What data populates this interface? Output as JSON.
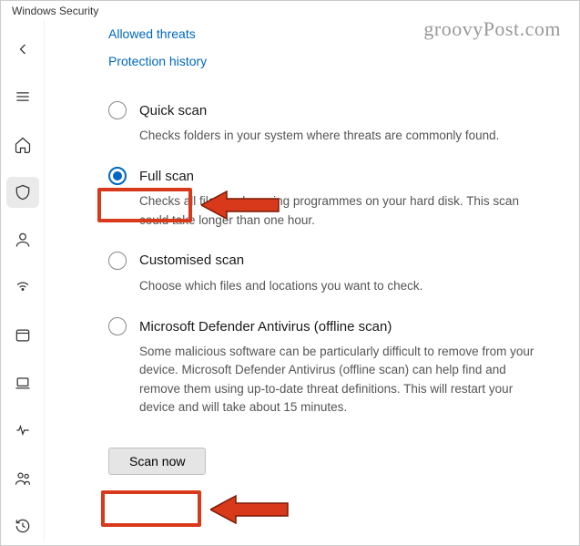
{
  "app_title": "Windows Security",
  "watermark": "groovyPost.com",
  "links": {
    "allowed_threats": "Allowed threats",
    "protection_history": "Protection history"
  },
  "options": [
    {
      "id": "quick",
      "label": "Quick scan",
      "desc": "Checks folders in your system where threats are commonly found.",
      "selected": false
    },
    {
      "id": "full",
      "label": "Full scan",
      "desc": "Checks all files and running programmes on your hard disk. This scan could take longer than one hour.",
      "selected": true
    },
    {
      "id": "custom",
      "label": "Customised scan",
      "desc": "Choose which files and locations you want to check.",
      "selected": false
    },
    {
      "id": "offline",
      "label": "Microsoft Defender Antivirus (offline scan)",
      "desc": "Some malicious software can be particularly difficult to remove from your device. Microsoft Defender Antivirus (offline scan) can help find and remove them using up-to-date threat definitions. This will restart your device and will take about 15 minutes.",
      "selected": false
    }
  ],
  "scan_button": "Scan now",
  "sidebar": {
    "items": [
      {
        "name": "back",
        "kind": "back-icon"
      },
      {
        "name": "menu",
        "kind": "menu-icon"
      },
      {
        "name": "home",
        "kind": "home-icon"
      },
      {
        "name": "virus",
        "kind": "shield-icon",
        "active": true
      },
      {
        "name": "account",
        "kind": "person-icon"
      },
      {
        "name": "firewall",
        "kind": "signal-icon"
      },
      {
        "name": "app-browser",
        "kind": "window-icon"
      },
      {
        "name": "device-security",
        "kind": "laptop-icon"
      },
      {
        "name": "performance",
        "kind": "heart-icon"
      },
      {
        "name": "family",
        "kind": "people-icon"
      },
      {
        "name": "protection-history",
        "kind": "history-icon"
      }
    ]
  },
  "annotations": {
    "highlight_full_scan": true,
    "highlight_scan_now": true,
    "arrow_color": "#d9391b"
  }
}
